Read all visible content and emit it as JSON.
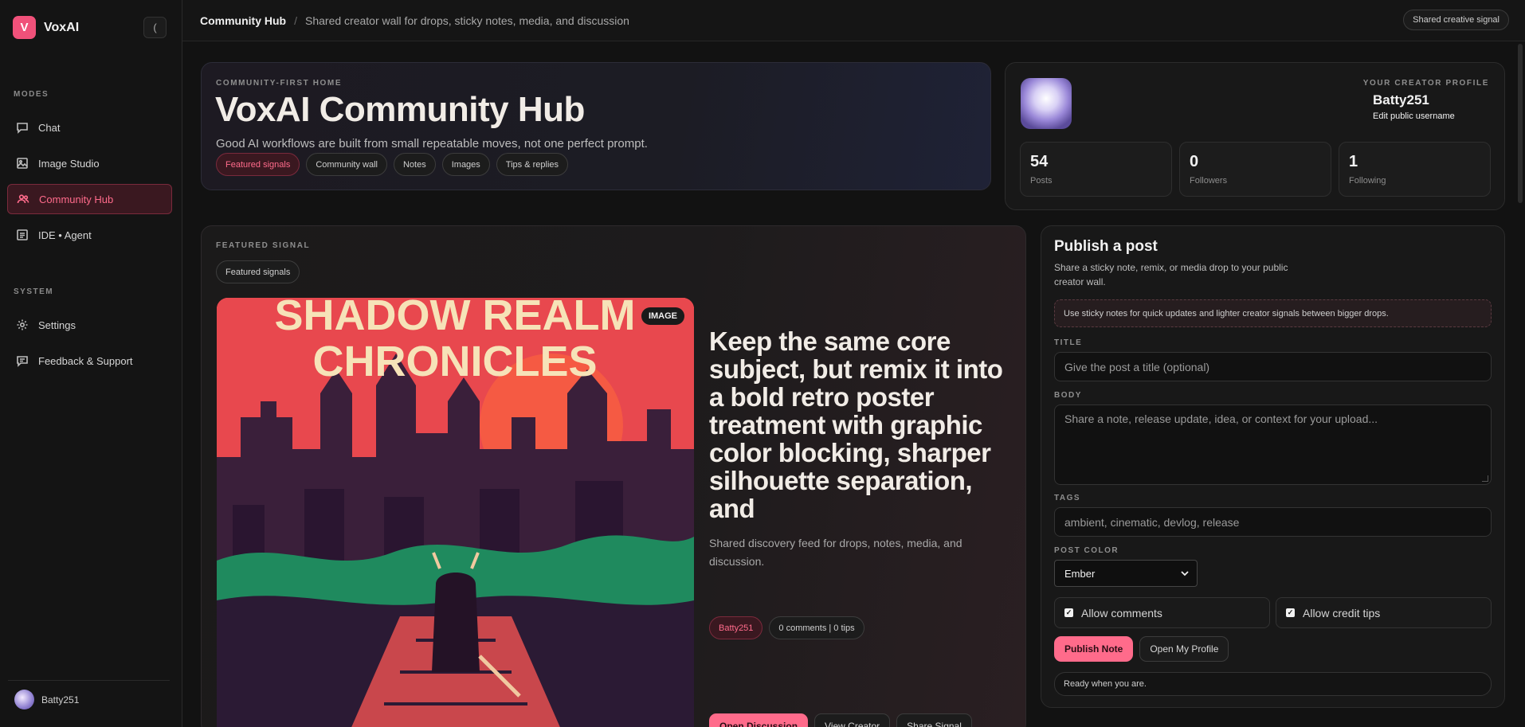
{
  "app": {
    "name": "VoxAI",
    "logo_letter": "V",
    "collapse_glyph": "("
  },
  "sidebar": {
    "modes_label": "MODES",
    "modes": [
      {
        "label": "Chat",
        "icon": "chat-icon"
      },
      {
        "label": "Image Studio",
        "icon": "image-icon"
      },
      {
        "label": "Community Hub",
        "icon": "users-icon",
        "active": true
      },
      {
        "label": "IDE • Agent",
        "icon": "code-icon"
      }
    ],
    "system_label": "SYSTEM",
    "system": [
      {
        "label": "Settings",
        "icon": "gear-icon"
      },
      {
        "label": "Feedback & Support",
        "icon": "message-icon"
      }
    ],
    "user": {
      "name": "Batty251"
    }
  },
  "topbar": {
    "title": "Community Hub",
    "separator": "/",
    "description": "Shared creator wall for drops, sticky notes, media, and discussion",
    "chip": "Shared creative signal"
  },
  "hero": {
    "kicker": "COMMUNITY-FIRST HOME",
    "title": "VoxAI Community Hub",
    "subtitle": "Good AI workflows are built from small repeatable moves, not one perfect prompt.",
    "chips": [
      "Featured signals",
      "Community wall",
      "Notes",
      "Images",
      "Tips & replies"
    ]
  },
  "profile": {
    "kicker": "YOUR CREATOR PROFILE",
    "name": "Batty251",
    "edit_link": "Edit public username",
    "stats": [
      {
        "value": "54",
        "label": "Posts"
      },
      {
        "value": "0",
        "label": "Followers"
      },
      {
        "value": "1",
        "label": "Following"
      }
    ]
  },
  "featured": {
    "kicker": "FEATURED SIGNAL",
    "chip": "Featured signals",
    "media_badge": "IMAGE",
    "poster_title_line1": "SHADOW REALM",
    "poster_title_line2": "CHRONICLES",
    "headline": "Keep the same core subject, but remix it into a bold retro poster treatment with graphic color blocking, sharper silhouette separation, and",
    "description": "Shared discovery feed for drops, notes, media, and discussion.",
    "author_tag": "Batty251",
    "meta_tag": "0 comments | 0 tips",
    "actions": [
      "Open Discussion",
      "View Creator",
      "Share Signal"
    ]
  },
  "publish": {
    "title": "Publish a post",
    "subtitle": "Share a sticky note, remix, or media drop to your public creator wall.",
    "hint": "Use sticky notes for quick updates and lighter creator signals between bigger drops.",
    "title_label": "TITLE",
    "title_placeholder": "Give the post a title (optional)",
    "body_label": "BODY",
    "body_placeholder": "Share a note, release update, idea, or context for your upload...",
    "tags_label": "TAGS",
    "tags_placeholder": "ambient, cinematic, devlog, release",
    "color_label": "POST COLOR",
    "color_value": "Ember",
    "allow_comments": "Allow comments",
    "allow_tips": "Allow credit tips",
    "publish_button": "Publish Note",
    "profile_button": "Open My Profile",
    "status": "Ready when you are."
  },
  "colors": {
    "accent": "#ff6b8b",
    "accent_dark_bg": "#3a1820",
    "poster_red": "#e8484e",
    "poster_green": "#1f8a5e"
  }
}
